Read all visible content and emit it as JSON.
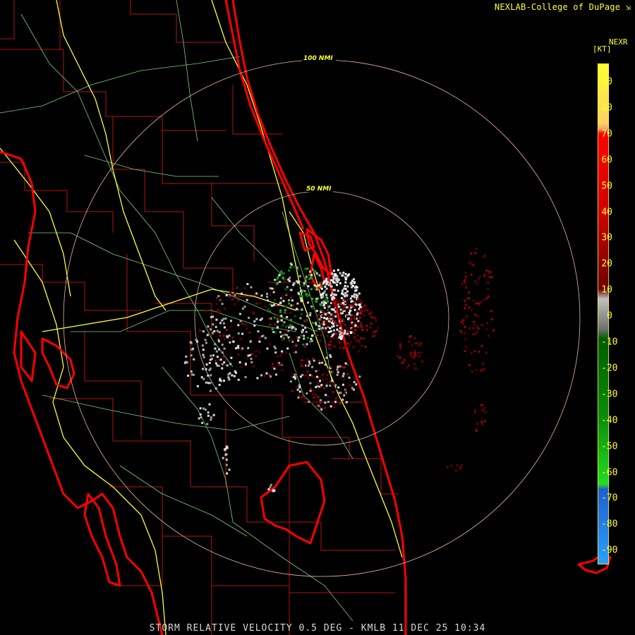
{
  "header": {
    "credit": "NEXLAB-College of DuPage"
  },
  "rings": [
    {
      "label": "100 NMI"
    },
    {
      "label": "50 NMI"
    }
  ],
  "legend": {
    "product": "NEXR",
    "unit": "[KT]",
    "ticks": [
      "90",
      "80",
      "70",
      "60",
      "50",
      "40",
      "30",
      "20",
      "10",
      "0",
      "-10",
      "-20",
      "-30",
      "-40",
      "-50",
      "-60",
      "-70",
      "-80",
      "-90"
    ],
    "colors": {
      "high_yellow": "#ffff33",
      "peach": "#f4a36c",
      "red": "#ff0000",
      "dark_red": "#6e0000",
      "gray": "#bdbdbd",
      "dark_green": "#005c00",
      "bright_green": "#22dd22",
      "blue": "#1f5fcf",
      "light_blue": "#2aa0ff"
    }
  },
  "map": {
    "radar_site": "KMLB",
    "colors": {
      "coast": "#ff0000",
      "county": "#b01414",
      "highway": "#ffff33",
      "road": "#7ecf7e",
      "ring": "#e8b8a0"
    }
  },
  "footer": {
    "caption": "STORM RELATIVE VELOCITY 0.5 DEG - KMLB 11 DEC 25 10:34"
  }
}
